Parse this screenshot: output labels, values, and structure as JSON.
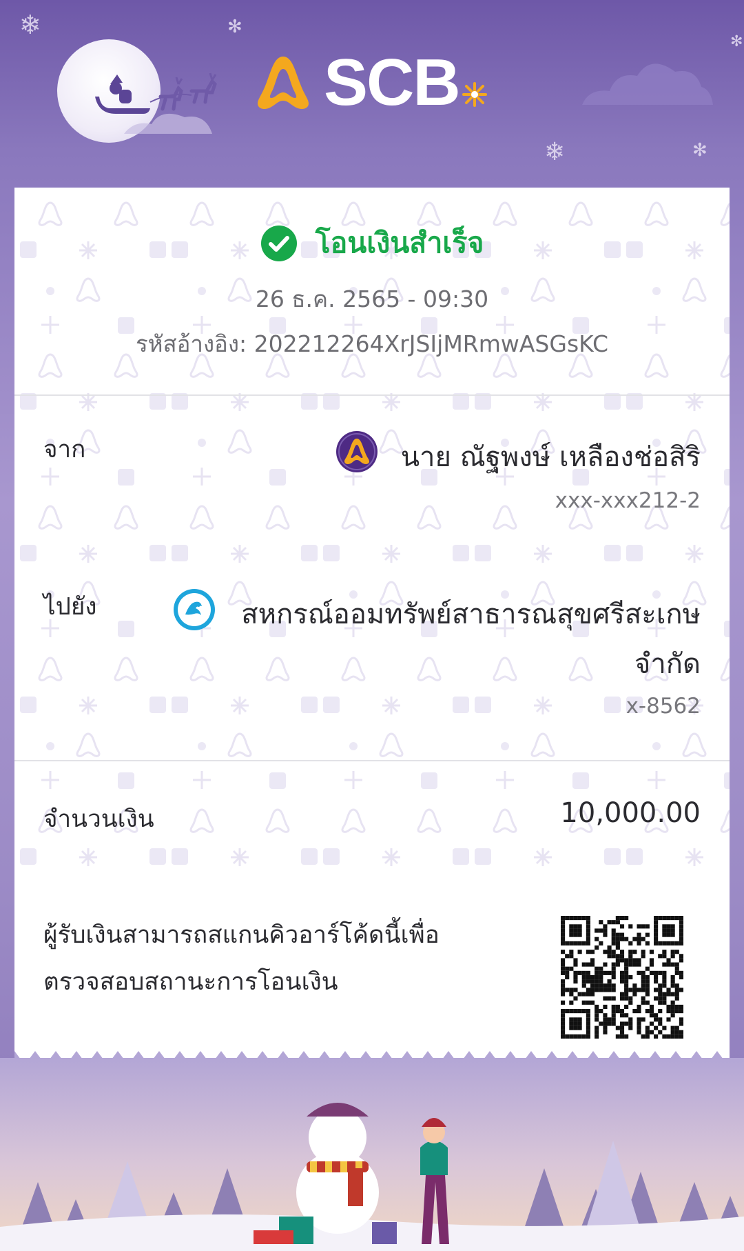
{
  "brand": {
    "name": "SCB"
  },
  "receipt": {
    "status": "โอนเงินสำเร็จ",
    "datetime": "26 ธ.ค. 2565 - 09:30",
    "reference_label": "รหัสอ้างอิง:",
    "reference_value": "202212264XrJSIjMRmwASGsKC",
    "from": {
      "label": "จาก",
      "name": "นาย ณัฐพงษ์ เหลืองช่อสิริ",
      "account": "xxx-xxx212-2"
    },
    "to": {
      "label": "ไปยัง",
      "name_line1": "สหกรณ์ออมทรัพย์สาธารณสุขศรีสะเกษ",
      "name_line2": "จำกัด",
      "account": "x-8562"
    },
    "amount": {
      "label": "จำนวนเงิน",
      "value": "10,000.00"
    },
    "qr_note_line1": "ผู้รับเงินสามารถสแกนคิวอาร์โค้ดนี้เพื่อ",
    "qr_note_line2": "ตรวจสอบสถานะการโอนเงิน"
  },
  "colors": {
    "brand_purple": "#6e58a8",
    "success_green": "#18a84a",
    "scb_gold": "#f4a81e",
    "ktb_blue": "#1ea5dc"
  },
  "icons": [
    "check-circle-icon",
    "scb-bell-icon",
    "krungthai-bank-icon",
    "qr-code-icon"
  ]
}
